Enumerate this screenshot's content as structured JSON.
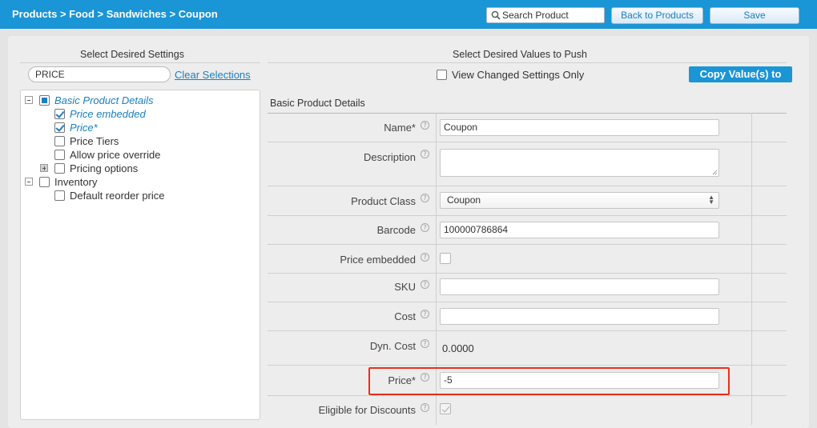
{
  "header": {
    "breadcrumb": "Products > Food > Sandwiches > Coupon",
    "search_placeholder": "Search Product",
    "back_label": "Back to Products",
    "save_label": "Save"
  },
  "left": {
    "title": "Select Desired Settings",
    "filter_value": "PRICE",
    "clear_label": "Clear Selections",
    "tree": {
      "basic": "Basic Product Details",
      "price_embedded": "Price embedded",
      "price": "Price*",
      "price_tiers": "Price Tiers",
      "allow_override": "Allow price override",
      "pricing_options": "Pricing options",
      "inventory": "Inventory",
      "default_reorder": "Default reorder price"
    }
  },
  "right": {
    "title": "Select Desired Values to Push",
    "view_changed_label": "View Changed Settings Only",
    "copy_label": "Copy Value(s) to",
    "section_label": "Basic Product Details",
    "help_glyph": "?",
    "fields": {
      "name": {
        "label": "Name*",
        "value": "Coupon"
      },
      "description": {
        "label": "Description",
        "value": ""
      },
      "product_class": {
        "label": "Product Class",
        "value": "Coupon"
      },
      "barcode": {
        "label": "Barcode",
        "value": "100000786864"
      },
      "price_embedded": {
        "label": "Price embedded"
      },
      "sku": {
        "label": "SKU",
        "value": ""
      },
      "cost": {
        "label": "Cost",
        "value": ""
      },
      "dyn_cost": {
        "label": "Dyn. Cost",
        "value": "0.0000"
      },
      "price": {
        "label": "Price*",
        "value": "-5"
      },
      "eligible_discounts": {
        "label": "Eligible for Discounts"
      }
    }
  },
  "colors": {
    "brand": "#1a95d6",
    "link": "#1a7fc0",
    "highlight": "#e5321f"
  }
}
